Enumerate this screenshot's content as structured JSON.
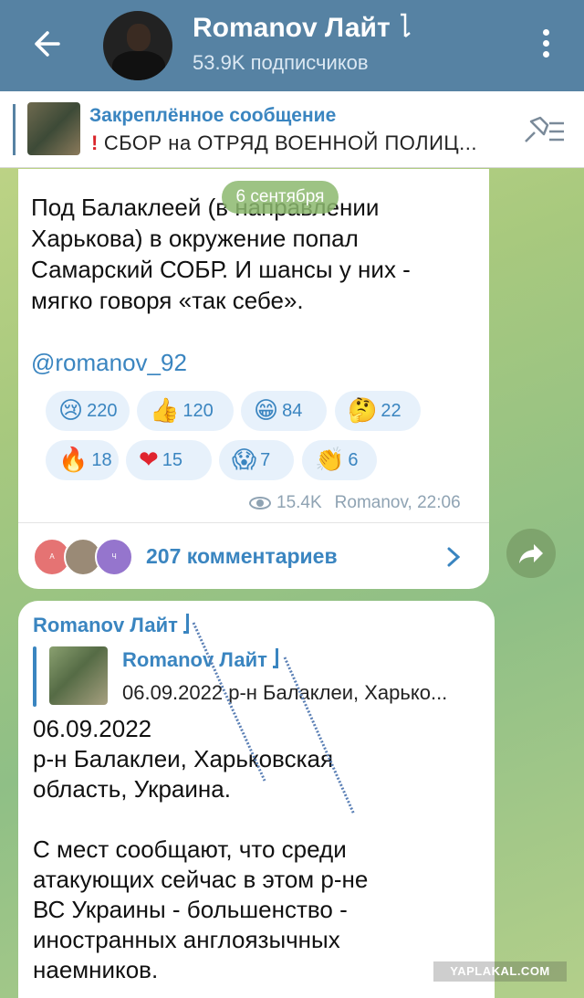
{
  "header": {
    "channel_name": "Romanov Лайт",
    "subscribers": "53.9K подписчиков"
  },
  "pinned": {
    "title": "Закреплённое сообщение",
    "text": "СБОР на ОТРЯД ВОЕННОЙ ПОЛИЦ...",
    "mark": "!"
  },
  "date_pill": "6 сентября",
  "post1": {
    "text": "Под Балаклеей (в направлении\nХарькова) в окружение попал\nСамарский СОБР. И шансы у них -\nмягко говоря «так себе».",
    "link": "@romanov_92",
    "reactions": [
      {
        "emoji": "😢",
        "count": "220"
      },
      {
        "emoji": "👍",
        "count": "120"
      },
      {
        "emoji": "😁",
        "count": "84"
      },
      {
        "emoji": "🤔",
        "count": "22"
      },
      {
        "emoji": "🔥",
        "count": "18"
      },
      {
        "emoji": "❤",
        "count": "15"
      },
      {
        "emoji": "😱",
        "count": "7"
      },
      {
        "emoji": "👏",
        "count": "6"
      }
    ],
    "views": "15.4K",
    "author_time": "Romanov, 22:06",
    "comment_avatars": [
      "А",
      "",
      "Ч"
    ],
    "comments": "207 комментариев"
  },
  "post2": {
    "author": "Romanov Лайт",
    "quote_author": "Romanov Лайт",
    "quote_text": "06.09.2022 р-н Балаклеи, Харько...",
    "text": "06.09.2022\nр-н Балаклеи, Харьковская\nобласть, Украина.\n\nС мест сообщают, что среди\nатакующих сейчас в этом р-не\nВС Украины - большенство -\nиностранных англоязычных\nнаемников."
  },
  "watermark": "YAPLAKAL.COM",
  "colors": {
    "header": "#5682a3",
    "accent": "#3a85c0",
    "reaction_bg": "#e7f1fb",
    "pin_mark": "#d9242a"
  }
}
